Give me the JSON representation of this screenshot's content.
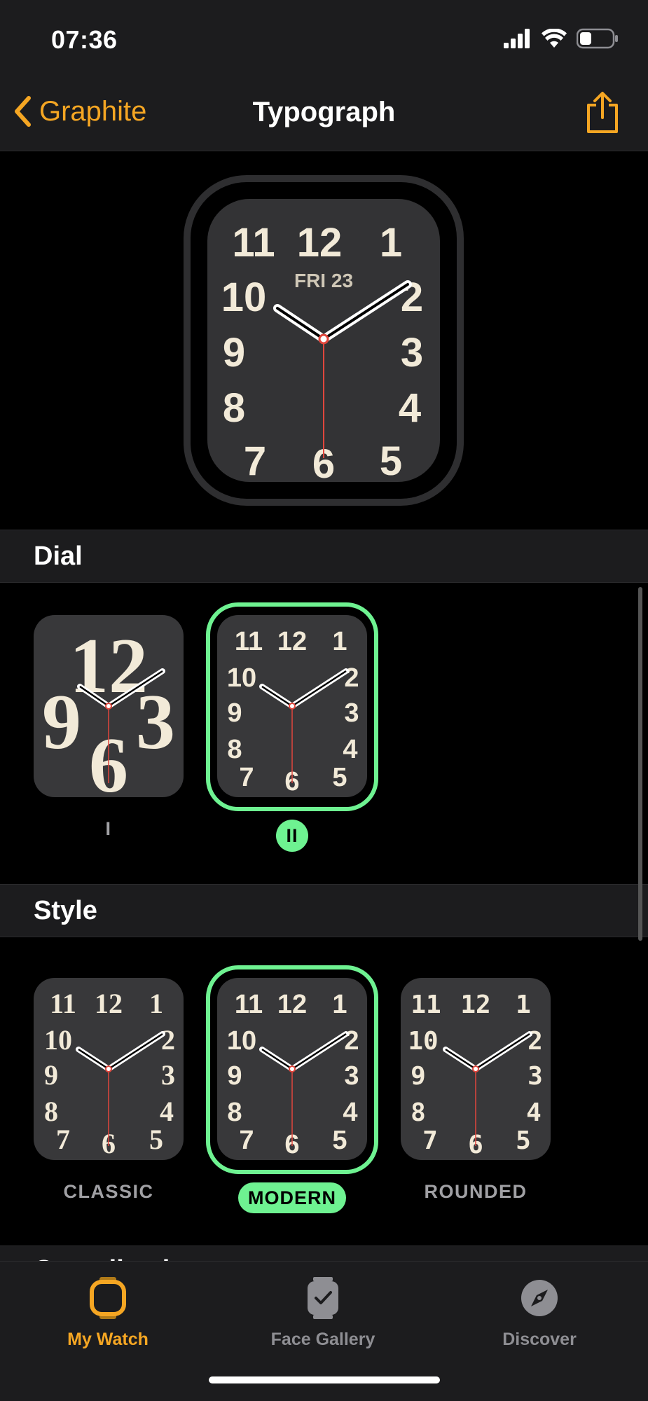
{
  "status_bar": {
    "time": "07:36"
  },
  "nav": {
    "back_label": "Graphite",
    "title": "Typograph"
  },
  "preview": {
    "date": "FRI 23",
    "numerals": [
      "12",
      "1",
      "2",
      "3",
      "4",
      "5",
      "6",
      "7",
      "8",
      "9",
      "10",
      "11"
    ]
  },
  "sections": {
    "dial": {
      "title": "Dial",
      "options": [
        {
          "label": "I",
          "selected": false
        },
        {
          "label": "II",
          "selected": true
        }
      ]
    },
    "style": {
      "title": "Style",
      "options": [
        {
          "label": "CLASSIC",
          "selected": false
        },
        {
          "label": "MODERN",
          "selected": true
        },
        {
          "label": "ROUNDED",
          "selected": false
        }
      ]
    },
    "next_title_partial": "Complications"
  },
  "tabbar": {
    "items": [
      {
        "label": "My Watch",
        "active": true
      },
      {
        "label": "Face Gallery",
        "active": false
      },
      {
        "label": "Discover",
        "active": false
      }
    ]
  },
  "colors": {
    "accent": "#f5a623",
    "selection": "#6ef291",
    "second_hand": "#e0463c",
    "inactive_tab": "#8e8e93"
  }
}
